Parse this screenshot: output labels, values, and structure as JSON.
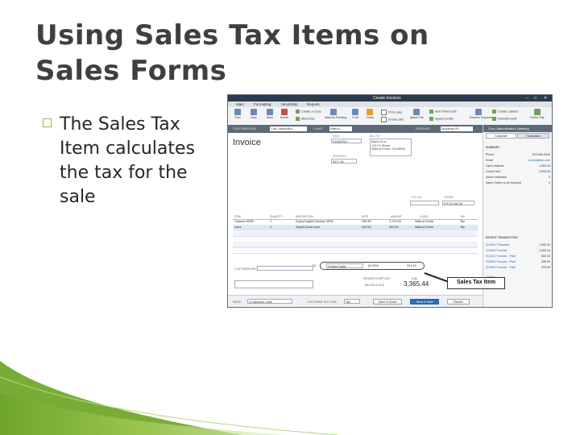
{
  "slide": {
    "title": "Using Sales Tax Items on Sales Forms",
    "bullet_icon": "square-bullet-icon",
    "bullet_text": "The Sales Tax Item calculates the tax for the sale",
    "accent_color": "#6aa321"
  },
  "window": {
    "title": "Create Invoices",
    "controls": [
      "–",
      "□",
      "✕"
    ],
    "menu_tabs": [
      "Main",
      "Formatting",
      "Send/Ship",
      "Reports"
    ],
    "toolbar": {
      "find": "Find",
      "new": "New",
      "save": "Save",
      "delete": "Delete",
      "create_copy": "Create a Copy",
      "memorize": "Memorize",
      "mark_pending": "Mark As Pending",
      "print": "Print",
      "email": "Email",
      "print_later": "Print Later",
      "email_later": "Email Later",
      "attach_file": "Attach File",
      "add_time_costs": "Add Time/Costs",
      "apply_credits": "Apply Credits",
      "receive_payments": "Receive Payments",
      "create_batch": "Create a Batch",
      "refund_credit": "Refund/Credit",
      "online_pay": "Online Pay"
    },
    "customer_bar": {
      "customer_job_label": "CUSTOMER:JOB",
      "customer_job_value": "Cruz, Maria:Bra...",
      "class_label": "CLASS",
      "class_value": "Walnut ...",
      "template_label": "TEMPLATE",
      "template_value": "Academy Ph..."
    },
    "invoice": {
      "heading": "Invoice",
      "date_label": "DATE",
      "date_value": "01/06/2017",
      "invoice_no_label": "INVOICE #",
      "invoice_no_value": "2017-61",
      "bill_to_label": "BILL TO",
      "bill_to_lines": [
        "Maria Cruz",
        "123 Fir Street",
        "Walnut Creek, CA 94596"
      ],
      "po_label": "P.O. NO.",
      "terms_label": "TERMS",
      "terms_value": "2% 10 Net 30"
    },
    "grid": {
      "headers": [
        "ITEM",
        "QUANTITY",
        "DESCRIPTION",
        "RATE",
        "AMOUNT",
        "CLASS",
        "TAX"
      ],
      "rows": [
        [
          "Camera SR32",
          "1",
          "Supra Digital Camera SR32",
          "295.99",
          "2,723.93",
          "Walnut Creek",
          "Tax"
        ],
        [
          "Lens",
          "1",
          "Supra Zoom Lens",
          "324.00",
          "324.00",
          "Walnut Creek",
          "Tax"
        ]
      ]
    },
    "lower": {
      "message_label": "CUSTOMER MESSAGE",
      "tax_label": "TAX",
      "tax_item": "Contra Costa",
      "tax_rate": "(8.25%)",
      "tax_amount": "251.43",
      "payments_label": "PAYMENTS APPLIED",
      "payments_value": "0.00",
      "balance_label": "BALANCE DUE",
      "balance_value": "3,365.44",
      "memo_label": "MEMO",
      "memo_value": "4 Cameras, Lens",
      "tax_code_label": "CUSTOMER TAX CODE",
      "tax_code_value": "Tax",
      "save_close": "Save & Close",
      "save_new": "Save & New",
      "revert": "Revert"
    },
    "panel": {
      "header": "Cruz, Maria:Branch Opening",
      "tabs": [
        "Customer",
        "Transaction"
      ],
      "summary_label": "SUMMARY",
      "summary": [
        {
          "k": "Phone",
          "v": "925-555-0344"
        },
        {
          "k": "Email",
          "v": "mcruz@abc.com"
        },
        {
          "k": "Open balance",
          "v": "1,350.44"
        },
        {
          "k": "Credit Limit",
          "v": "3,000.00"
        },
        {
          "k": "Active estimates",
          "v": "0"
        },
        {
          "k": "Sales Orders to be invoiced",
          "v": "0"
        }
      ],
      "recent_label": "RECENT TRANSACTION",
      "recent": [
        {
          "k": "01/06/17 Payment",
          "v": "1,550.00"
        },
        {
          "k": "01/06/17 Invoice",
          "v": "3,365.44"
        },
        {
          "k": "01/12/17 Invoice - Paid",
          "v": "800.00"
        },
        {
          "k": "01/05/17 Invoice - Paid",
          "v": "556.00"
        },
        {
          "k": "01/05/17 Invoice - Paid",
          "v": "575.00"
        }
      ],
      "notes_label": "NOTES"
    }
  },
  "callout": {
    "text": "Sales Tax Item"
  }
}
